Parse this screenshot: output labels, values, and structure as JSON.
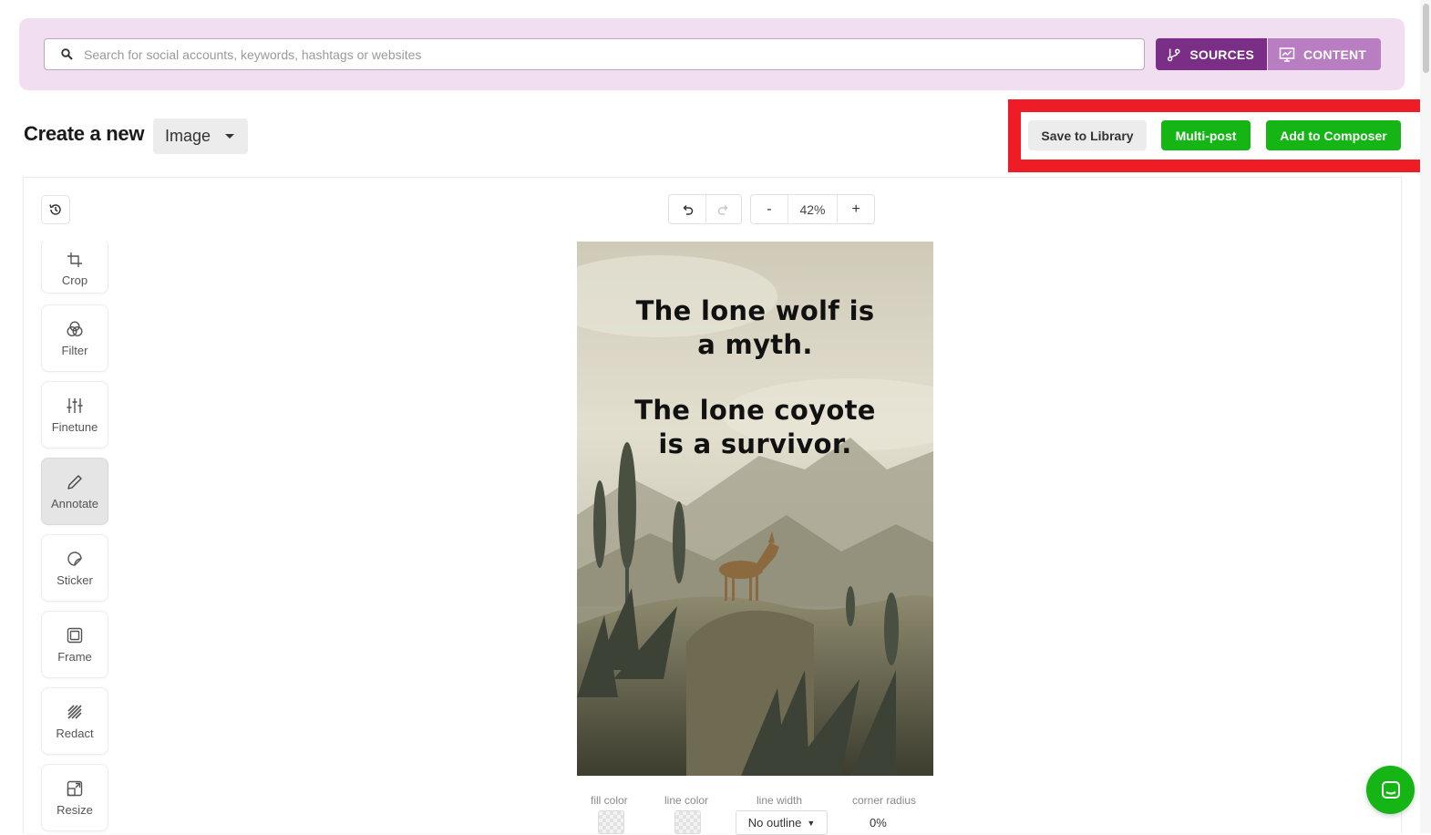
{
  "search": {
    "placeholder": "Search for social accounts, keywords, hashtags or websites",
    "value": ""
  },
  "segments": {
    "sources_label": "SOURCES",
    "content_label": "CONTENT"
  },
  "header": {
    "title": "Create a new",
    "type_value": "Image"
  },
  "actions": {
    "save_label": "Save to Library",
    "multipost_label": "Multi-post",
    "composer_label": "Add to Composer"
  },
  "zoom": {
    "value": "42%",
    "minus": "-",
    "plus": "+"
  },
  "tools": [
    {
      "label": "Crop",
      "icon": "crop-icon"
    },
    {
      "label": "Filter",
      "icon": "filter-icon"
    },
    {
      "label": "Finetune",
      "icon": "sliders-icon"
    },
    {
      "label": "Annotate",
      "icon": "pencil-icon",
      "active": true
    },
    {
      "label": "Sticker",
      "icon": "sticker-icon"
    },
    {
      "label": "Frame",
      "icon": "frame-icon"
    },
    {
      "label": "Redact",
      "icon": "redact-icon"
    },
    {
      "label": "Resize",
      "icon": "resize-icon"
    }
  ],
  "canvas": {
    "line1": "The lone wolf is",
    "line2": "a myth.",
    "line3": "The lone coyote",
    "line4": "is a survivor."
  },
  "properties": {
    "fill_label": "fill color",
    "line_color_label": "line color",
    "line_width_label": "line width",
    "line_width_value": "No outline",
    "corner_radius_label": "corner radius",
    "corner_radius_value": "0%"
  },
  "colors": {
    "sources": "#7a2e86",
    "content": "#b97ec1",
    "topbar": "#f1dff1",
    "green": "#14b514",
    "highlight": "#ee1c24"
  }
}
